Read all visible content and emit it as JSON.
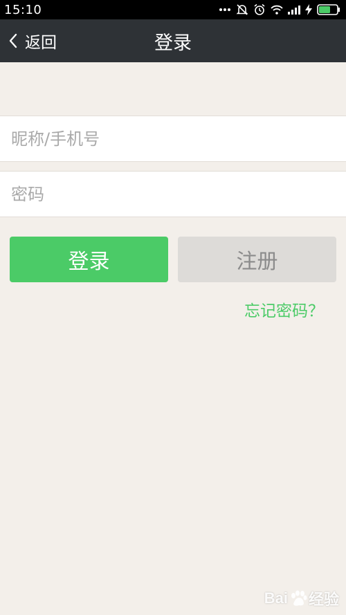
{
  "status_bar": {
    "time": "15:10",
    "icons": [
      "more-dots-icon",
      "alarm-off-icon",
      "alarm-icon",
      "wifi-icon",
      "signal-icon",
      "charging-bolt-icon",
      "battery-icon"
    ]
  },
  "header": {
    "back_label": "返回",
    "title": "登录"
  },
  "form": {
    "username_placeholder": "昵称/手机号",
    "password_placeholder": "密码",
    "username_value": "",
    "password_value": ""
  },
  "actions": {
    "login_label": "登录",
    "register_label": "注册",
    "forgot_password_label": "忘记密码？"
  },
  "watermark": {
    "text_left": "Bai",
    "text_right": "经验"
  },
  "colors": {
    "accent": "#4bcb67",
    "title_bar": "#2e3236",
    "background": "#f3efea",
    "secondary_button": "#dddbd8"
  }
}
